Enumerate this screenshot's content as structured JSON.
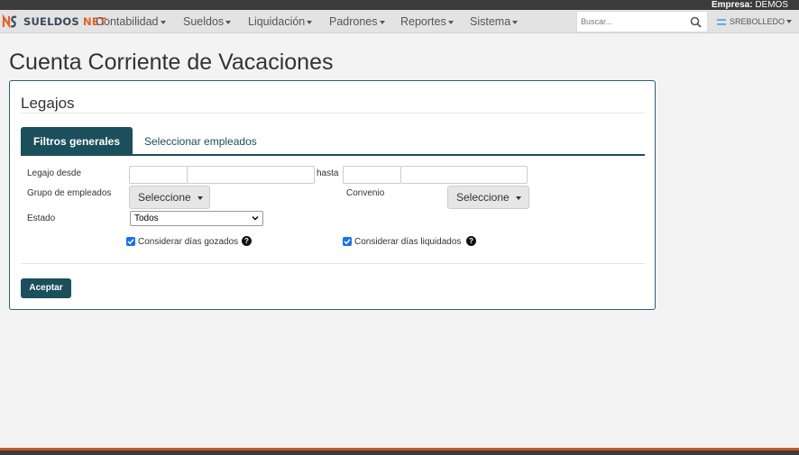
{
  "topbar": {
    "empresa_label": "Empresa:",
    "empresa_value": "DEMOS"
  },
  "brand": {
    "part1": "SUELDOS",
    "part2": "NET"
  },
  "nav": [
    {
      "label": "Contabilidad"
    },
    {
      "label": "Sueldos"
    },
    {
      "label": "Liquidación"
    },
    {
      "label": "Padrones"
    },
    {
      "label": "Reportes"
    },
    {
      "label": "Sistema"
    }
  ],
  "search": {
    "placeholder": "Buscar..."
  },
  "user": {
    "name": "SREBOLLEDO"
  },
  "page": {
    "title": "Cuenta Corriente de Vacaciones"
  },
  "panel": {
    "title": "Legajos"
  },
  "tabs": {
    "active": "Filtros generales",
    "other": "Seleccionar empleados"
  },
  "form": {
    "legajo_desde": "Legajo desde",
    "hasta": "hasta",
    "grupo": "Grupo de empleados",
    "convenio": "Convenio",
    "estado": "Estado",
    "estado_value": "Todos",
    "seleccione": "Seleccione",
    "gozados": "Considerar días gozados",
    "liquidados": "Considerar días liquidados",
    "aceptar": "Aceptar"
  },
  "colors": {
    "primary": "#1b4f5b",
    "brand_accent": "#e0622a",
    "checkbox": "#1a73e8"
  }
}
